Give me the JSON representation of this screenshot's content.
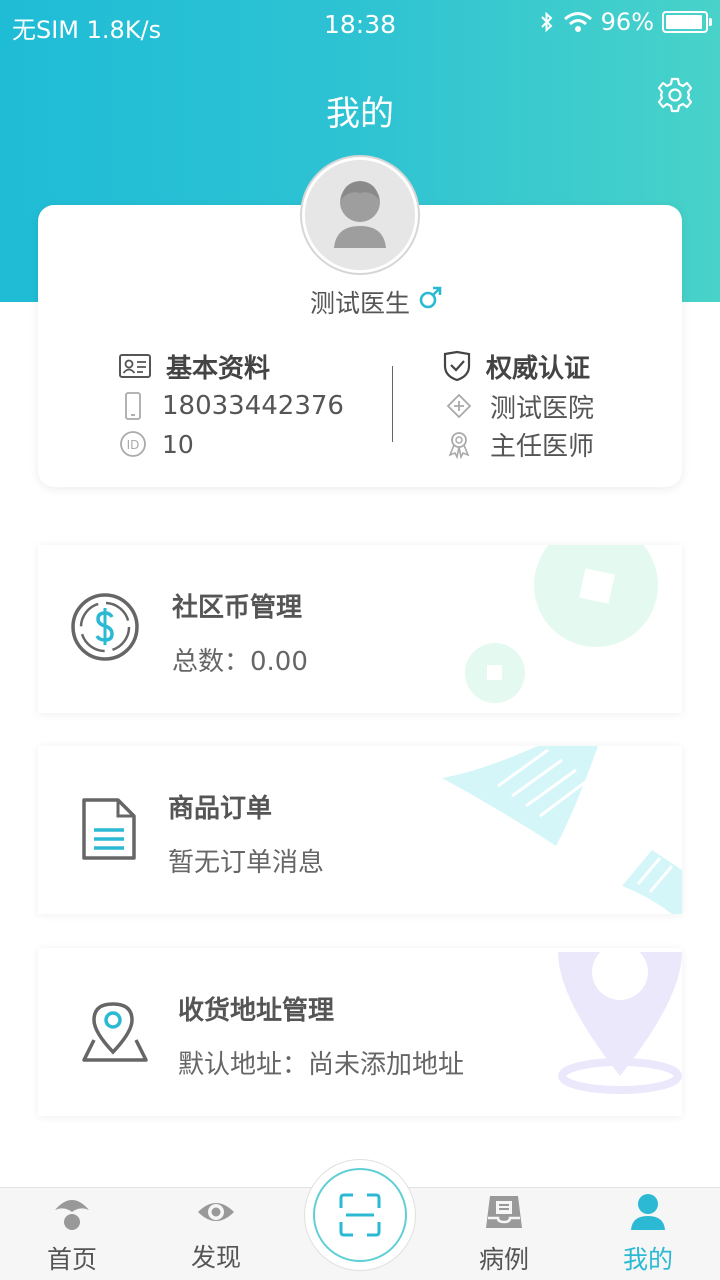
{
  "status_bar": {
    "left": "无SIM 1.8K/s",
    "time": "18:38",
    "battery": "96%"
  },
  "header": {
    "title": "我的",
    "settings_icon": "gear-icon"
  },
  "profile": {
    "name": "测试医生",
    "gender": "male",
    "basic_info": {
      "heading": "基本资料",
      "phone": "18033442376",
      "id": "10"
    },
    "certification": {
      "heading": "权威认证",
      "hospital": "测试医院",
      "title": "主任医师"
    }
  },
  "menu": {
    "coins": {
      "title": "社区币管理",
      "subtitle": "总数：0.00"
    },
    "orders": {
      "title": "商品订单",
      "subtitle": "暂无订单消息"
    },
    "address": {
      "title": "收货地址管理",
      "subtitle": "默认地址：尚未添加地址"
    }
  },
  "tabbar": {
    "home": "首页",
    "discover": "发现",
    "cases": "病例",
    "mine": "我的"
  },
  "colors": {
    "accent": "#2bb9d4",
    "header_start": "#1fbcd6",
    "header_end": "#48d2c9"
  }
}
